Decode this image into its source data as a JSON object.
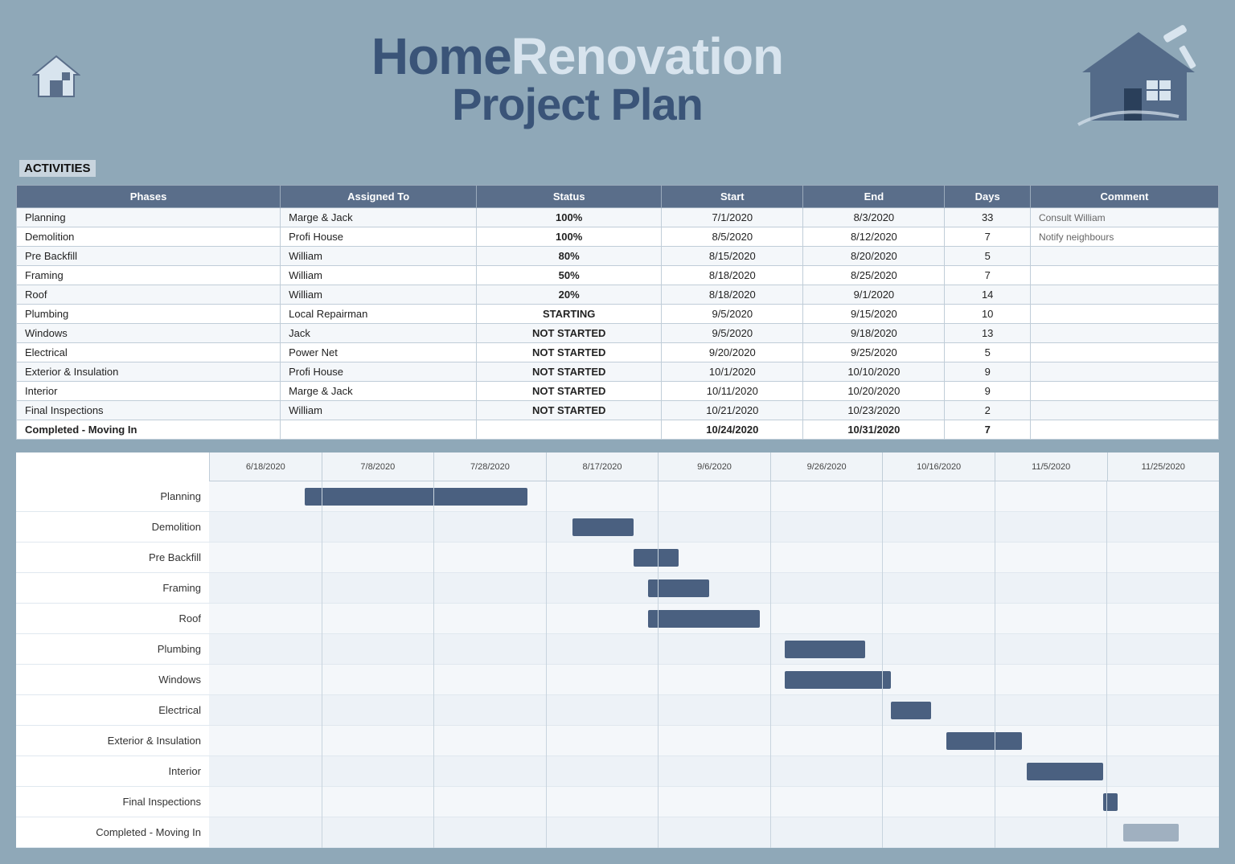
{
  "header": {
    "title_line1_dark": "Home",
    "title_line1_light": "Renovation",
    "title_line2": "Project Plan",
    "section_label": "ACTIVITIES"
  },
  "table": {
    "columns": [
      "Phases",
      "Assigned To",
      "Status",
      "Start",
      "End",
      "Days",
      "Comment"
    ],
    "rows": [
      {
        "phase": "Planning",
        "assigned": "Marge & Jack",
        "status": "100%",
        "status_class": "status-100",
        "start": "7/1/2020",
        "end": "8/3/2020",
        "days": "33",
        "comment": "Consult William"
      },
      {
        "phase": "Demolition",
        "assigned": "Profi House",
        "status": "100%",
        "status_class": "status-100",
        "start": "8/5/2020",
        "end": "8/12/2020",
        "days": "7",
        "comment": "Notify neighbours"
      },
      {
        "phase": "Pre Backfill",
        "assigned": "William",
        "status": "80%",
        "status_class": "status-80",
        "start": "8/15/2020",
        "end": "8/20/2020",
        "days": "5",
        "comment": ""
      },
      {
        "phase": "Framing",
        "assigned": "William",
        "status": "50%",
        "status_class": "status-50",
        "start": "8/18/2020",
        "end": "8/25/2020",
        "days": "7",
        "comment": ""
      },
      {
        "phase": "Roof",
        "assigned": "William",
        "status": "20%",
        "status_class": "status-20",
        "start": "8/18/2020",
        "end": "9/1/2020",
        "days": "14",
        "comment": ""
      },
      {
        "phase": "Plumbing",
        "assigned": "Local Repairman",
        "status": "STARTING",
        "status_class": "status-starting",
        "start": "9/5/2020",
        "end": "9/15/2020",
        "days": "10",
        "comment": ""
      },
      {
        "phase": "Windows",
        "assigned": "Jack",
        "status": "NOT STARTED",
        "status_class": "status-not-started",
        "start": "9/5/2020",
        "end": "9/18/2020",
        "days": "13",
        "comment": ""
      },
      {
        "phase": "Electrical",
        "assigned": "Power Net",
        "status": "NOT STARTED",
        "status_class": "status-not-started",
        "start": "9/20/2020",
        "end": "9/25/2020",
        "days": "5",
        "comment": ""
      },
      {
        "phase": "Exterior & Insulation",
        "assigned": "Profi House",
        "status": "NOT STARTED",
        "status_class": "status-not-started",
        "start": "10/1/2020",
        "end": "10/10/2020",
        "days": "9",
        "comment": ""
      },
      {
        "phase": "Interior",
        "assigned": "Marge & Jack",
        "status": "NOT STARTED",
        "status_class": "status-not-started",
        "start": "10/11/2020",
        "end": "10/20/2020",
        "days": "9",
        "comment": ""
      },
      {
        "phase": "Final Inspections",
        "assigned": "William",
        "status": "NOT STARTED",
        "status_class": "status-not-started",
        "start": "10/21/2020",
        "end": "10/23/2020",
        "days": "2",
        "comment": ""
      },
      {
        "phase": "Completed - Moving In",
        "assigned": "",
        "status": "",
        "status_class": "",
        "start": "10/24/2020",
        "end": "10/31/2020",
        "days": "7",
        "comment": "",
        "bold": true
      }
    ]
  },
  "gantt": {
    "date_labels": [
      "6/18/2020",
      "7/8/2020",
      "7/28/2020",
      "8/17/2020",
      "9/6/2020",
      "9/26/2020",
      "10/16/2020",
      "11/5/2020",
      "11/25/2020"
    ],
    "rows": [
      {
        "label": "Planning",
        "bar_color": "bar-blue",
        "left_pct": 9.5,
        "width_pct": 22
      },
      {
        "label": "Demolition",
        "bar_color": "bar-blue",
        "left_pct": 36,
        "width_pct": 6
      },
      {
        "label": "Pre Backfill",
        "bar_color": "bar-blue",
        "left_pct": 42,
        "width_pct": 4.5
      },
      {
        "label": "Framing",
        "bar_color": "bar-blue",
        "left_pct": 43.5,
        "width_pct": 6
      },
      {
        "label": "Roof",
        "bar_color": "bar-blue",
        "left_pct": 43.5,
        "width_pct": 11
      },
      {
        "label": "Plumbing",
        "bar_color": "bar-blue",
        "left_pct": 57,
        "width_pct": 8
      },
      {
        "label": "Windows",
        "bar_color": "bar-blue",
        "left_pct": 57,
        "width_pct": 10.5
      },
      {
        "label": "Electrical",
        "bar_color": "bar-blue",
        "left_pct": 67.5,
        "width_pct": 4
      },
      {
        "label": "Exterior & Insulation",
        "bar_color": "bar-blue",
        "left_pct": 73,
        "width_pct": 7.5
      },
      {
        "label": "Interior",
        "bar_color": "bar-blue",
        "left_pct": 81,
        "width_pct": 7.5
      },
      {
        "label": "Final Inspections",
        "bar_color": "bar-blue",
        "left_pct": 88.5,
        "width_pct": 1.5
      },
      {
        "label": "Completed - Moving In",
        "bar_color": "bar-gray",
        "left_pct": 90.5,
        "width_pct": 5.5
      }
    ]
  },
  "colors": {
    "background": "#8fa8b8",
    "header_row": "#5a6e8a",
    "bar_blue": "#4a6080",
    "bar_gray": "#a0b0c0"
  }
}
